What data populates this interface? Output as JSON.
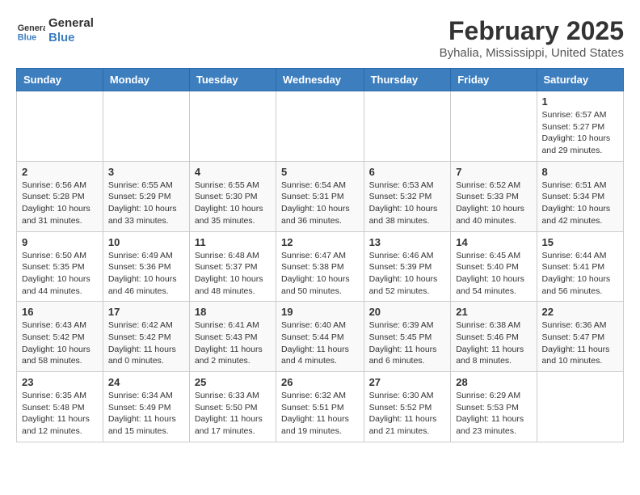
{
  "header": {
    "logo_line1": "General",
    "logo_line2": "Blue",
    "month_title": "February 2025",
    "location": "Byhalia, Mississippi, United States"
  },
  "weekdays": [
    "Sunday",
    "Monday",
    "Tuesday",
    "Wednesday",
    "Thursday",
    "Friday",
    "Saturday"
  ],
  "weeks": [
    [
      {
        "day": "",
        "info": ""
      },
      {
        "day": "",
        "info": ""
      },
      {
        "day": "",
        "info": ""
      },
      {
        "day": "",
        "info": ""
      },
      {
        "day": "",
        "info": ""
      },
      {
        "day": "",
        "info": ""
      },
      {
        "day": "1",
        "info": "Sunrise: 6:57 AM\nSunset: 5:27 PM\nDaylight: 10 hours\nand 29 minutes."
      }
    ],
    [
      {
        "day": "2",
        "info": "Sunrise: 6:56 AM\nSunset: 5:28 PM\nDaylight: 10 hours\nand 31 minutes."
      },
      {
        "day": "3",
        "info": "Sunrise: 6:55 AM\nSunset: 5:29 PM\nDaylight: 10 hours\nand 33 minutes."
      },
      {
        "day": "4",
        "info": "Sunrise: 6:55 AM\nSunset: 5:30 PM\nDaylight: 10 hours\nand 35 minutes."
      },
      {
        "day": "5",
        "info": "Sunrise: 6:54 AM\nSunset: 5:31 PM\nDaylight: 10 hours\nand 36 minutes."
      },
      {
        "day": "6",
        "info": "Sunrise: 6:53 AM\nSunset: 5:32 PM\nDaylight: 10 hours\nand 38 minutes."
      },
      {
        "day": "7",
        "info": "Sunrise: 6:52 AM\nSunset: 5:33 PM\nDaylight: 10 hours\nand 40 minutes."
      },
      {
        "day": "8",
        "info": "Sunrise: 6:51 AM\nSunset: 5:34 PM\nDaylight: 10 hours\nand 42 minutes."
      }
    ],
    [
      {
        "day": "9",
        "info": "Sunrise: 6:50 AM\nSunset: 5:35 PM\nDaylight: 10 hours\nand 44 minutes."
      },
      {
        "day": "10",
        "info": "Sunrise: 6:49 AM\nSunset: 5:36 PM\nDaylight: 10 hours\nand 46 minutes."
      },
      {
        "day": "11",
        "info": "Sunrise: 6:48 AM\nSunset: 5:37 PM\nDaylight: 10 hours\nand 48 minutes."
      },
      {
        "day": "12",
        "info": "Sunrise: 6:47 AM\nSunset: 5:38 PM\nDaylight: 10 hours\nand 50 minutes."
      },
      {
        "day": "13",
        "info": "Sunrise: 6:46 AM\nSunset: 5:39 PM\nDaylight: 10 hours\nand 52 minutes."
      },
      {
        "day": "14",
        "info": "Sunrise: 6:45 AM\nSunset: 5:40 PM\nDaylight: 10 hours\nand 54 minutes."
      },
      {
        "day": "15",
        "info": "Sunrise: 6:44 AM\nSunset: 5:41 PM\nDaylight: 10 hours\nand 56 minutes."
      }
    ],
    [
      {
        "day": "16",
        "info": "Sunrise: 6:43 AM\nSunset: 5:42 PM\nDaylight: 10 hours\nand 58 minutes."
      },
      {
        "day": "17",
        "info": "Sunrise: 6:42 AM\nSunset: 5:42 PM\nDaylight: 11 hours\nand 0 minutes."
      },
      {
        "day": "18",
        "info": "Sunrise: 6:41 AM\nSunset: 5:43 PM\nDaylight: 11 hours\nand 2 minutes."
      },
      {
        "day": "19",
        "info": "Sunrise: 6:40 AM\nSunset: 5:44 PM\nDaylight: 11 hours\nand 4 minutes."
      },
      {
        "day": "20",
        "info": "Sunrise: 6:39 AM\nSunset: 5:45 PM\nDaylight: 11 hours\nand 6 minutes."
      },
      {
        "day": "21",
        "info": "Sunrise: 6:38 AM\nSunset: 5:46 PM\nDaylight: 11 hours\nand 8 minutes."
      },
      {
        "day": "22",
        "info": "Sunrise: 6:36 AM\nSunset: 5:47 PM\nDaylight: 11 hours\nand 10 minutes."
      }
    ],
    [
      {
        "day": "23",
        "info": "Sunrise: 6:35 AM\nSunset: 5:48 PM\nDaylight: 11 hours\nand 12 minutes."
      },
      {
        "day": "24",
        "info": "Sunrise: 6:34 AM\nSunset: 5:49 PM\nDaylight: 11 hours\nand 15 minutes."
      },
      {
        "day": "25",
        "info": "Sunrise: 6:33 AM\nSunset: 5:50 PM\nDaylight: 11 hours\nand 17 minutes."
      },
      {
        "day": "26",
        "info": "Sunrise: 6:32 AM\nSunset: 5:51 PM\nDaylight: 11 hours\nand 19 minutes."
      },
      {
        "day": "27",
        "info": "Sunrise: 6:30 AM\nSunset: 5:52 PM\nDaylight: 11 hours\nand 21 minutes."
      },
      {
        "day": "28",
        "info": "Sunrise: 6:29 AM\nSunset: 5:53 PM\nDaylight: 11 hours\nand 23 minutes."
      },
      {
        "day": "",
        "info": ""
      }
    ]
  ]
}
